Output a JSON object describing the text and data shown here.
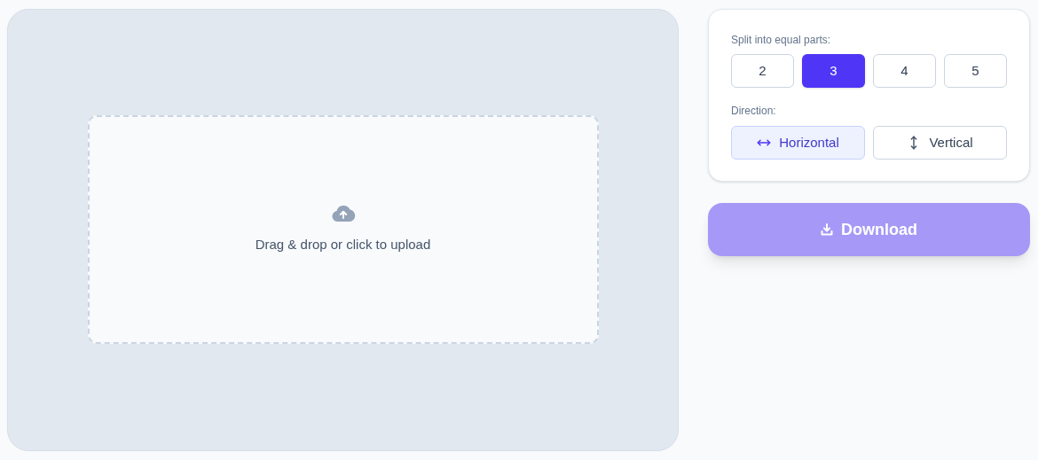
{
  "upload": {
    "prompt": "Drag & drop or click to upload"
  },
  "split": {
    "label": "Split into equal parts:",
    "options": [
      {
        "label": "2",
        "selected": false
      },
      {
        "label": "3",
        "selected": true
      },
      {
        "label": "4",
        "selected": false
      },
      {
        "label": "5",
        "selected": false
      }
    ]
  },
  "direction": {
    "label": "Direction:",
    "options": [
      {
        "label": "Horizontal",
        "kind": "horizontal",
        "selected": true
      },
      {
        "label": "Vertical",
        "kind": "vertical",
        "selected": false
      }
    ]
  },
  "download": {
    "label": "Download",
    "disabled": true
  }
}
